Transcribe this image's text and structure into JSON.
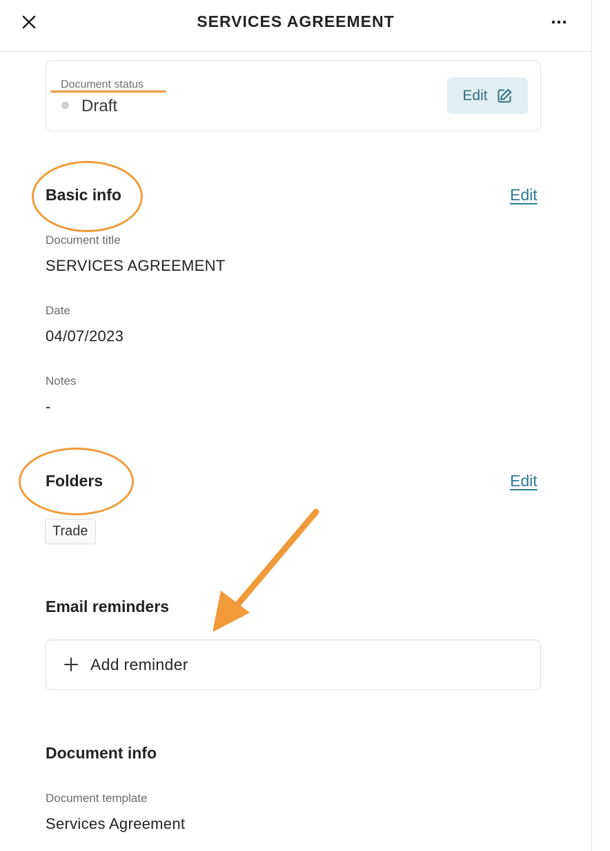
{
  "header": {
    "title": "SERVICES AGREEMENT",
    "close_icon": "close-icon",
    "more_icon": "more-horizontal-icon"
  },
  "status": {
    "label": "Document status",
    "value": "Draft",
    "edit_label": "Edit",
    "edit_icon": "edit-pencil-icon"
  },
  "basic_info": {
    "title": "Basic info",
    "edit_label": "Edit",
    "fields": [
      {
        "label": "Document title",
        "value": "SERVICES AGREEMENT"
      },
      {
        "label": "Date",
        "value": "04/07/2023"
      },
      {
        "label": "Notes",
        "value": "-"
      }
    ]
  },
  "folders": {
    "title": "Folders",
    "edit_label": "Edit",
    "tags": [
      "Trade"
    ]
  },
  "email_reminders": {
    "title": "Email reminders",
    "add_label": "Add reminder"
  },
  "document_info": {
    "title": "Document info",
    "fields": [
      {
        "label": "Document template",
        "value": "Services Agreement"
      }
    ]
  },
  "colors": {
    "accent_link": "#2f7c97",
    "edit_button_bg": "#e1eff3",
    "annotation_orange": "#f19a3a",
    "status_dot": "#cfcfcf"
  }
}
